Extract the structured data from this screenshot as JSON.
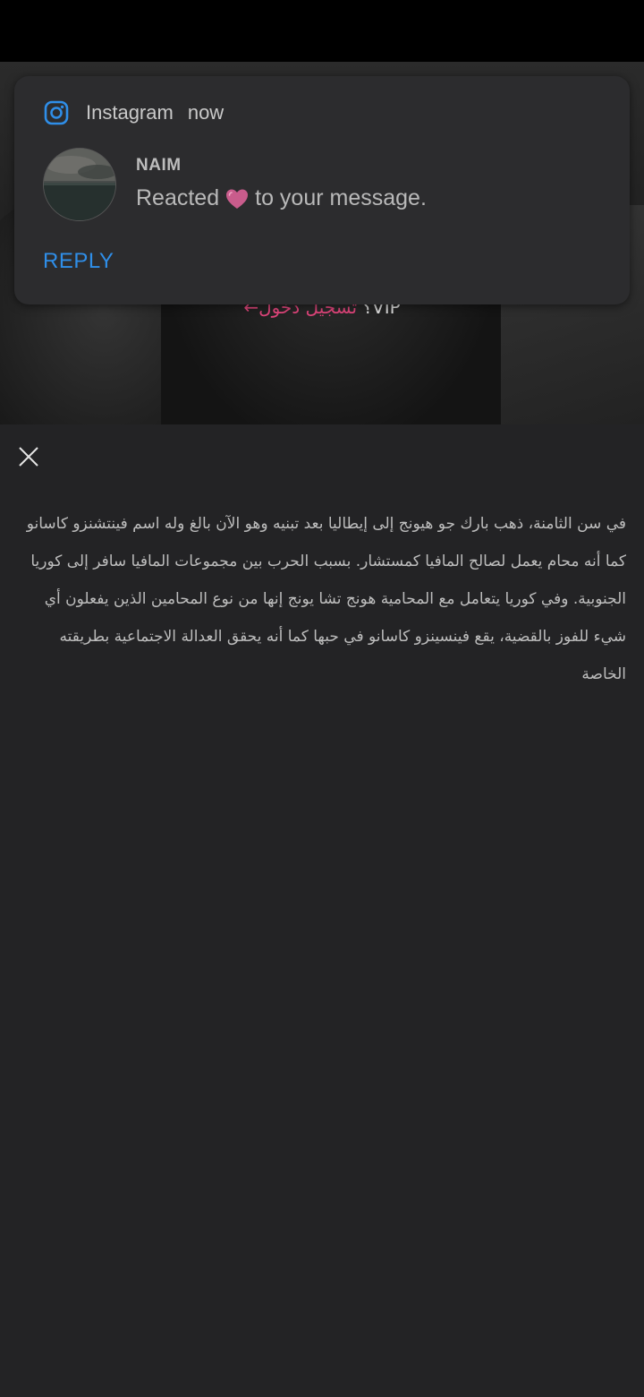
{
  "notification": {
    "app_name": "Instagram",
    "time": "now",
    "sender": "NAIM",
    "message_before": "Reacted",
    "message_after": "to your message.",
    "reaction_icon": "heart-icon",
    "reply_label": "REPLY",
    "accent_color": "#2f8ee8"
  },
  "hero": {
    "vip_text": "VIP؟",
    "login_link": "تسجيل دخول←"
  },
  "article": {
    "text": "في سن الثامنة، ذهب بارك جو هيونج إلى إيطاليا بعد تبنيه وهو الآن بالغ وله اسم فينتشنزو كاسانو كما أنه محام يعمل لصالح المافيا كمستشار. بسبب الحرب بين مجموعات المافيا سافر إلى كوريا الجنوبية. وفي كوريا يتعامل مع المحامية هونج تشا يونج إنها من نوع المحامين الذين يفعلون أي شيء للفوز بالقضية، يقع فينسينزو كاسانو في حبها كما أنه يحقق العدالة الاجتماعية بطريقته الخاصة"
  },
  "controls": {
    "close_icon": "close-icon"
  }
}
